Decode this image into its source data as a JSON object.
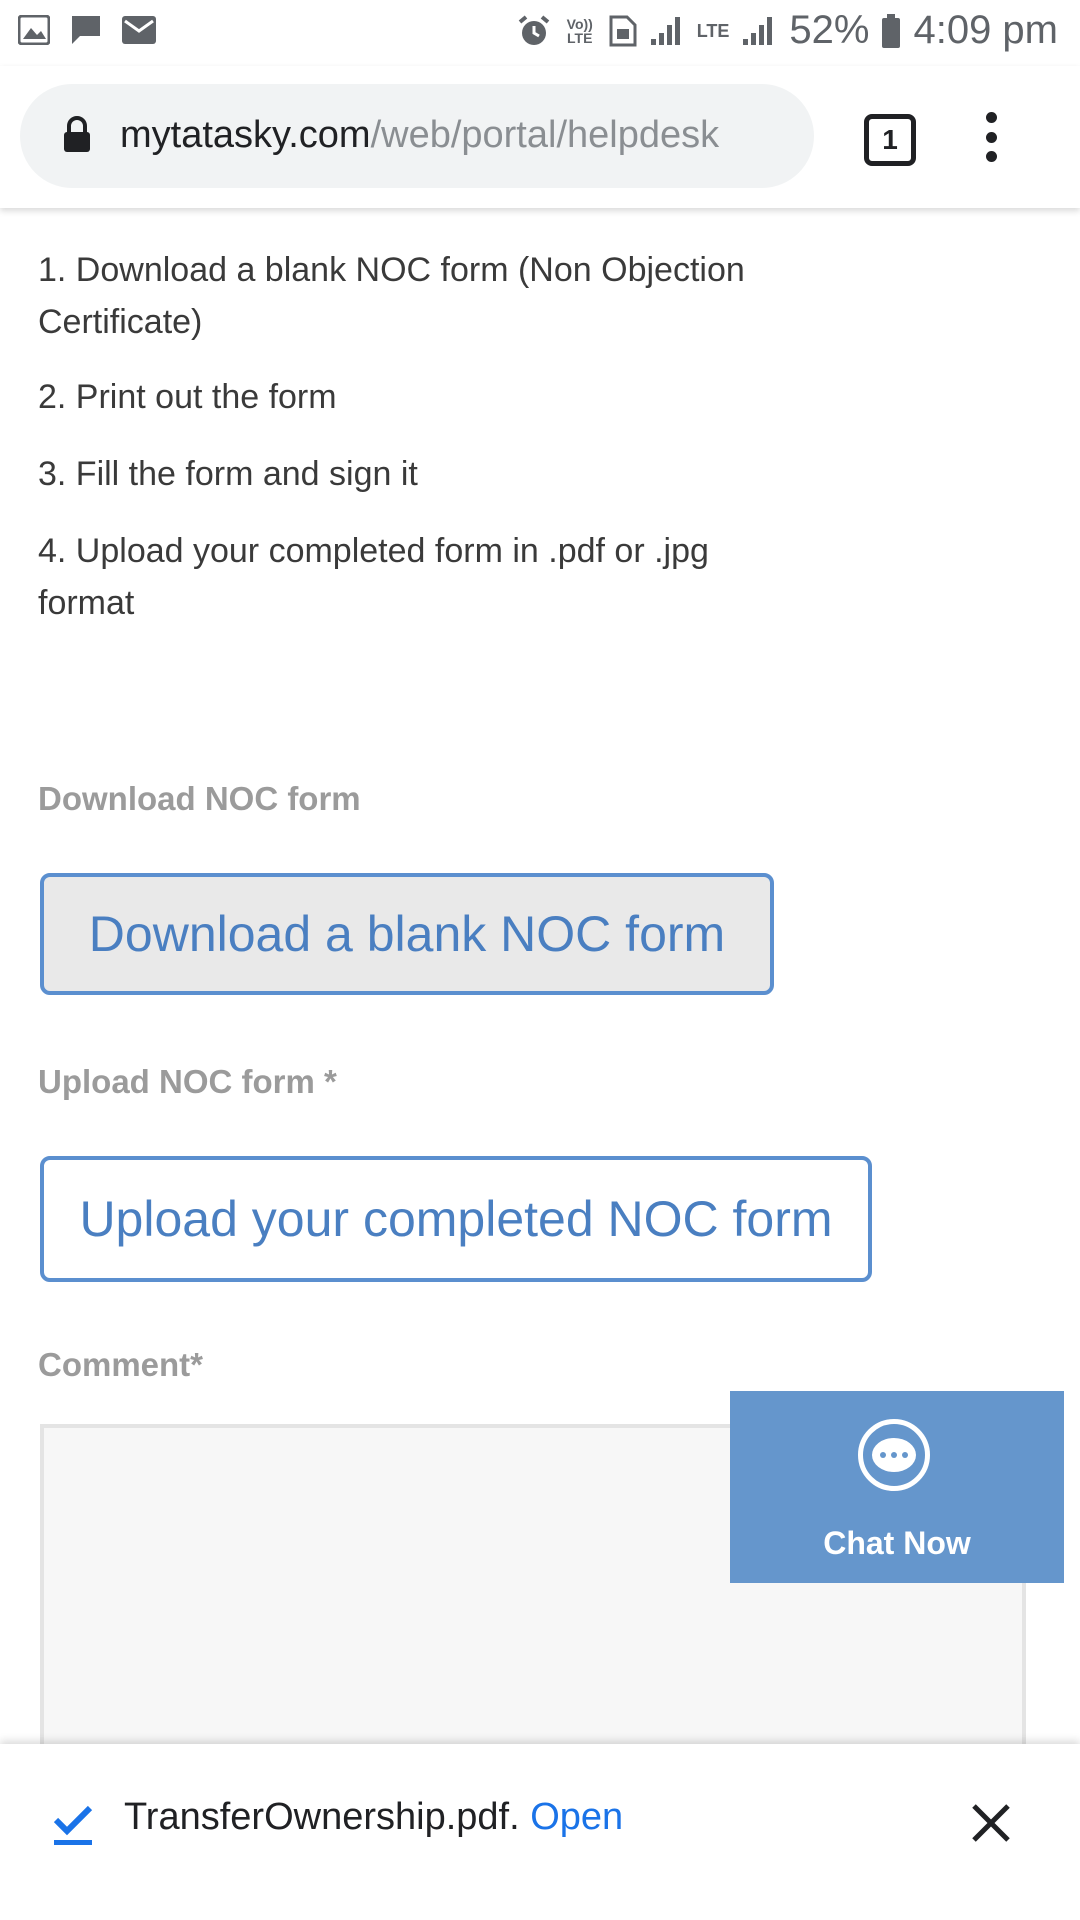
{
  "status_bar": {
    "battery": "52%",
    "time": "4:09 pm",
    "volte": "Vo)) LTE",
    "lte": "LTE"
  },
  "browser": {
    "url_domain": "mytatasky.com",
    "url_path": "/web/portal/helpdesk",
    "tab_count": "1"
  },
  "content": {
    "steps": [
      "1. Download a blank NOC form (Non Objection Certificate)",
      "2. Print out the form",
      "3. Fill the form and sign it",
      "4. Upload your completed form in .pdf or .jpg format"
    ],
    "download_label": "Download NOC form",
    "download_button": "Download a blank NOC form",
    "upload_label": "Upload NOC form *",
    "upload_button": "Upload your completed NOC form",
    "comment_label": "Comment*"
  },
  "chat": {
    "label": "Chat Now",
    "icon": "chat-bubble-icon",
    "color": "#6596cc"
  },
  "download_bar": {
    "filename": "TransferOwnership.pdf.",
    "open_label": "Open"
  },
  "colors": {
    "accent": "#4a7fc1",
    "link": "#1a73e8"
  }
}
